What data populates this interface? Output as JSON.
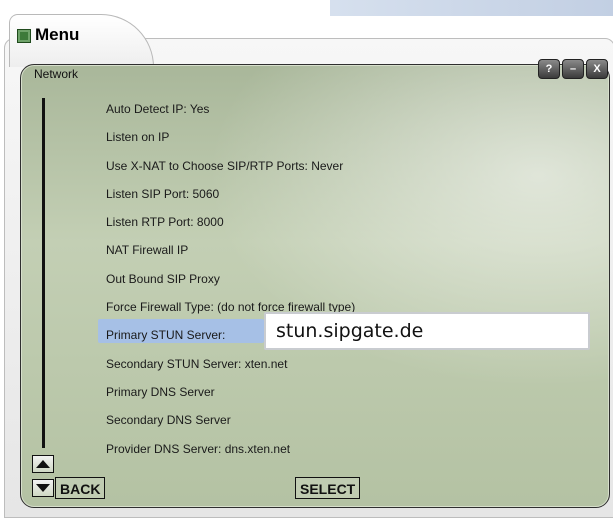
{
  "window": {
    "title": "Menu",
    "section": "Network",
    "controls": {
      "help": "?",
      "minimize": "–",
      "close": "X"
    }
  },
  "menu": {
    "items": [
      {
        "label": "Auto Detect IP: Yes"
      },
      {
        "label": "Listen on IP"
      },
      {
        "label": "Use X-NAT to Choose SIP/RTP Ports: Never"
      },
      {
        "label": "Listen SIP Port: 5060"
      },
      {
        "label": "Listen RTP Port: 8000"
      },
      {
        "label": "NAT Firewall IP"
      },
      {
        "label": "Out Bound SIP Proxy"
      },
      {
        "label": "Force Firewall Type: (do not force firewall type)"
      },
      {
        "label": "Primary STUN Server:"
      },
      {
        "label": "Secondary STUN Server: xten.net"
      },
      {
        "label": "Primary DNS Server"
      },
      {
        "label": "Secondary DNS Server"
      },
      {
        "label": "Provider DNS Server: dns.xten.net"
      }
    ],
    "selected_index": 8,
    "edit_value": "stun.sipgate.de"
  },
  "softkeys": {
    "back": "BACK",
    "select": "SELECT"
  },
  "colors": {
    "panel": "#b8c5a8",
    "highlight": "#a6c0e6",
    "accent_icon": "#3d7a3a"
  }
}
